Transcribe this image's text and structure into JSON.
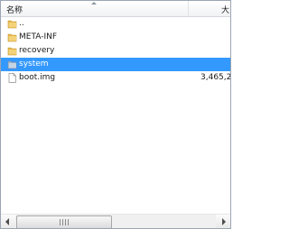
{
  "header": {
    "name_label": "名称",
    "size_label": "大"
  },
  "rows": [
    {
      "name": "..",
      "size": "",
      "icon": "folder-icon"
    },
    {
      "name": "META-INF",
      "size": "",
      "icon": "folder-icon"
    },
    {
      "name": "recovery",
      "size": "",
      "icon": "folder-icon"
    },
    {
      "name": "system",
      "size": "",
      "icon": "folder-icon",
      "selected": true
    },
    {
      "name": "boot.img",
      "size": "3,465,2",
      "icon": "file-icon"
    }
  ],
  "colors": {
    "selection": "#3399ff",
    "folder": "#e8b94a"
  }
}
